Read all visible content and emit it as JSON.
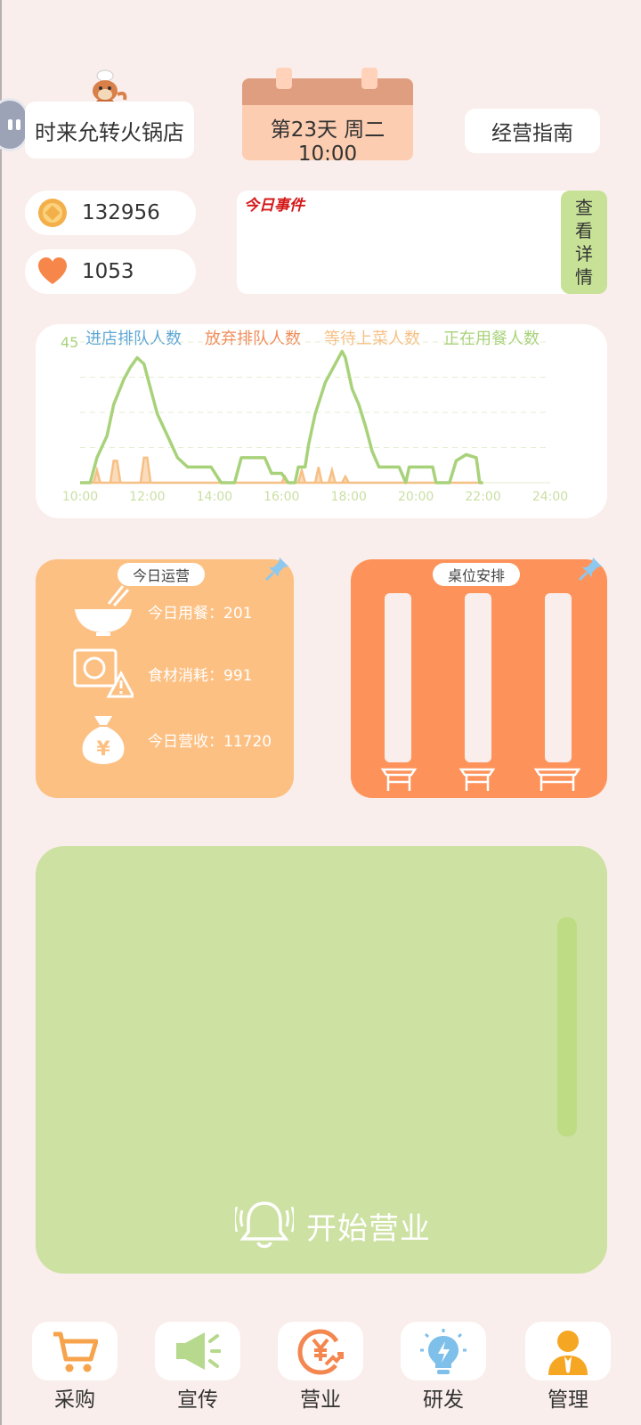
{
  "shop": {
    "name": "时来允转火锅店"
  },
  "calendar": {
    "day": "第23天 周二",
    "time": "10:00"
  },
  "guide": {
    "label": "经营指南"
  },
  "stats": {
    "coins": "132956",
    "hearts": "1053"
  },
  "events": {
    "title": "今日事件",
    "detail_button": [
      "查",
      "看",
      "详",
      "情"
    ]
  },
  "chart_data": {
    "type": "line",
    "x_ticks": [
      "10:00",
      "12:00",
      "14:00",
      "16:00",
      "18:00",
      "20:00",
      "22:00",
      "24:00"
    ],
    "xlim": [
      10,
      24
    ],
    "ylim": [
      0,
      45
    ],
    "y_tick_label": "45",
    "grid": true,
    "legend_position": "top",
    "series": [
      {
        "name": "进店排队人数",
        "color": "#5fa7d6",
        "points": []
      },
      {
        "name": "放弃排队人数",
        "color": "#f08c5a",
        "points": []
      },
      {
        "name": "等待上菜人数",
        "color": "#f6c085",
        "points": [
          [
            10,
            0
          ],
          [
            10.4,
            0
          ],
          [
            10.5,
            4
          ],
          [
            10.6,
            0
          ],
          [
            10.9,
            0
          ],
          [
            11.0,
            7
          ],
          [
            11.1,
            7
          ],
          [
            11.2,
            0
          ],
          [
            11.8,
            0
          ],
          [
            11.9,
            8
          ],
          [
            12.0,
            8
          ],
          [
            12.1,
            0
          ],
          [
            16.0,
            0
          ],
          [
            16.1,
            2
          ],
          [
            16.2,
            0
          ],
          [
            16.5,
            0
          ],
          [
            16.6,
            4
          ],
          [
            16.7,
            0
          ],
          [
            17.0,
            0
          ],
          [
            17.1,
            5
          ],
          [
            17.2,
            0
          ],
          [
            17.4,
            0
          ],
          [
            17.5,
            4
          ],
          [
            17.6,
            0
          ],
          [
            17.8,
            0
          ],
          [
            17.9,
            2
          ],
          [
            18.0,
            0
          ],
          [
            22,
            0
          ]
        ]
      },
      {
        "name": "正在用餐人数",
        "color": "#a8d27a",
        "points": [
          [
            10,
            0
          ],
          [
            10.3,
            0
          ],
          [
            10.5,
            8
          ],
          [
            10.8,
            15
          ],
          [
            11.0,
            25
          ],
          [
            11.3,
            33
          ],
          [
            11.5,
            37
          ],
          [
            11.7,
            40
          ],
          [
            11.9,
            38
          ],
          [
            12.1,
            30
          ],
          [
            12.3,
            22
          ],
          [
            12.6,
            15
          ],
          [
            12.9,
            8
          ],
          [
            13.2,
            5
          ],
          [
            13.6,
            5
          ],
          [
            13.9,
            5
          ],
          [
            14.2,
            0
          ],
          [
            14.6,
            0
          ],
          [
            14.8,
            8
          ],
          [
            15.1,
            8
          ],
          [
            15.5,
            8
          ],
          [
            15.7,
            3
          ],
          [
            16.0,
            3
          ],
          [
            16.2,
            0
          ],
          [
            16.4,
            0
          ],
          [
            16.5,
            5
          ],
          [
            16.7,
            5
          ],
          [
            16.8,
            12
          ],
          [
            17.0,
            22
          ],
          [
            17.3,
            32
          ],
          [
            17.6,
            38
          ],
          [
            17.8,
            42
          ],
          [
            17.9,
            40
          ],
          [
            18.1,
            30
          ],
          [
            18.3,
            25
          ],
          [
            18.5,
            18
          ],
          [
            18.7,
            10
          ],
          [
            18.9,
            5
          ],
          [
            19.3,
            5
          ],
          [
            19.5,
            5
          ],
          [
            19.7,
            0
          ],
          [
            19.8,
            5
          ],
          [
            20.3,
            5
          ],
          [
            20.5,
            5
          ],
          [
            20.6,
            0
          ],
          [
            21.0,
            0
          ],
          [
            21.2,
            7
          ],
          [
            21.5,
            9
          ],
          [
            21.8,
            8
          ],
          [
            21.9,
            0
          ],
          [
            22,
            0
          ]
        ]
      }
    ]
  },
  "ops": {
    "title": "今日运营",
    "rows": [
      {
        "icon": "bowl-icon",
        "label": "今日用餐：201"
      },
      {
        "icon": "ingredient-warning-icon",
        "label": "食材消耗：991"
      },
      {
        "icon": "money-bag-icon",
        "label": "今日营收：11720"
      }
    ]
  },
  "tables": {
    "title": "桌位安排"
  },
  "service": {
    "start_label": "开始营业"
  },
  "nav": [
    {
      "label": "采购",
      "icon": "cart-icon"
    },
    {
      "label": "宣传",
      "icon": "megaphone-icon"
    },
    {
      "label": "营业",
      "icon": "yen-exchange-icon"
    },
    {
      "label": "研发",
      "icon": "bulb-icon"
    },
    {
      "label": "管理",
      "icon": "manager-icon"
    }
  ],
  "colors": {
    "background": "#f9eeeb",
    "ops_card": "#fdc083",
    "tables_card": "#fd935a",
    "service_panel": "#cde1a3",
    "accent_green": "#c7e196"
  }
}
